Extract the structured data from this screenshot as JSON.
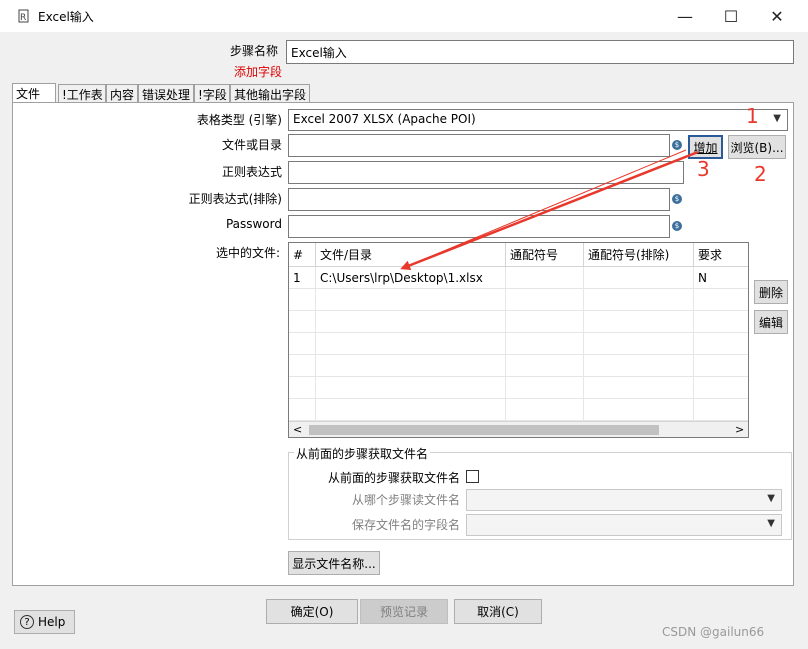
{
  "window": {
    "title": "Excel输入",
    "minimize_glyph": "—",
    "maximize_glyph": "☐",
    "close_glyph": "✕"
  },
  "step": {
    "name_label": "步骤名称",
    "name_value": "Excel输入",
    "add_field_link": "添加字段"
  },
  "tabs": [
    "文件",
    "!工作表",
    "内容",
    "错误处理",
    "!字段",
    "其他输出字段"
  ],
  "form": {
    "sheet_type_label": "表格类型 (引擎)",
    "sheet_type_value": "Excel 2007 XLSX (Apache POI)",
    "file_dir_label": "文件或目录",
    "file_dir_value": "",
    "add_button": "增加",
    "browse_button": "浏览(B)...",
    "regex_label": "正则表达式",
    "regex_exclude_label": "正则表达式(排除)",
    "password_label": "Password",
    "selected_files_label": "选中的文件:",
    "delete_button": "删除",
    "edit_button": "编辑",
    "variable_icon": "$"
  },
  "table": {
    "sort_glyph": "^",
    "columns": [
      "#",
      "文件/目录",
      "通配符号",
      "通配符号(排除)",
      "要求"
    ],
    "rows": [
      [
        "1",
        "C:\\Users\\lrp\\Desktop\\1.xlsx",
        "",
        "",
        "N"
      ]
    ],
    "scroll_left": "<",
    "scroll_right": ">"
  },
  "prev_step": {
    "group_title": "从前面的步骤获取文件名",
    "checkbox_label": "从前面的步骤获取文件名",
    "from_step_label": "从哪个步骤读文件名",
    "field_name_label": "保存文件名的字段名"
  },
  "show_filenames_button": "显示文件名称...",
  "footer": {
    "help_button": "Help",
    "ok_button": "确定(O)",
    "preview_button": "预览记录",
    "cancel_button": "取消(C)"
  },
  "annotations": {
    "n1": "1",
    "n2": "2",
    "n3": "3",
    "arrow_color": "#e8382b"
  },
  "watermark": "CSDN @gailun66"
}
